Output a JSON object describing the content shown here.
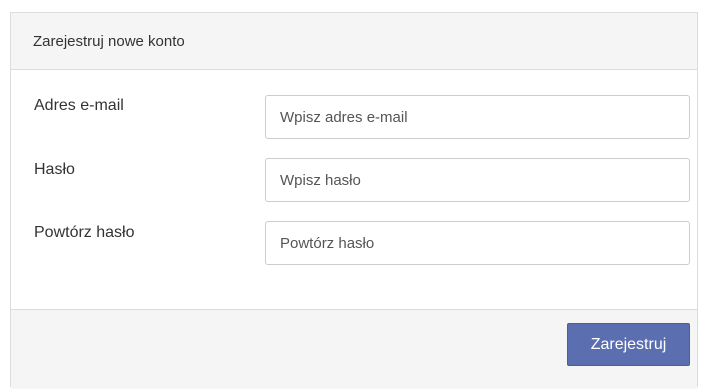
{
  "panel": {
    "title": "Zarejestruj nowe konto"
  },
  "form": {
    "email": {
      "label": "Adres e-mail",
      "placeholder": "Wpisz adres e-mail",
      "value": ""
    },
    "password": {
      "label": "Hasło",
      "placeholder": "Wpisz hasło",
      "value": ""
    },
    "confirm_password": {
      "label": "Powtórz hasło",
      "placeholder": "Powtórz hasło",
      "value": ""
    }
  },
  "footer": {
    "submit_label": "Zarejestruj"
  },
  "colors": {
    "accent": "#5a6eb0",
    "header_bg": "#f5f5f5",
    "border": "#dcdcdc"
  }
}
